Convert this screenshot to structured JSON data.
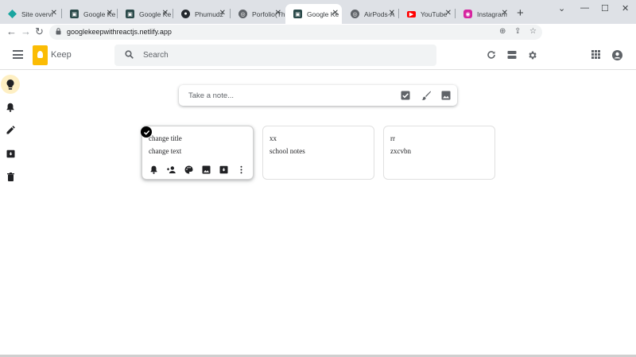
{
  "browser": {
    "tabs": [
      {
        "title": "Site overvi",
        "favicon": "diamond-icon",
        "color": "#1aa5a0"
      },
      {
        "title": "Google Ke",
        "favicon": "keep-icon",
        "color": "#2b4a4a"
      },
      {
        "title": "Google Ke",
        "favicon": "keep-icon",
        "color": "#2b4a4a"
      },
      {
        "title": "Phumudz",
        "favicon": "github-icon",
        "color": "#24292e"
      },
      {
        "title": "Porfolio(Th",
        "favicon": "globe-icon",
        "color": "#5f6368"
      },
      {
        "title": "Google Ke",
        "favicon": "keep-icon",
        "color": "#2b4a4a"
      },
      {
        "title": "AirPods-A",
        "favicon": "globe-icon",
        "color": "#5f6368"
      },
      {
        "title": "YouTube",
        "favicon": "youtube-icon",
        "color": "#ff0000"
      },
      {
        "title": "Instagram",
        "favicon": "instagram-icon",
        "color": "#d6249f"
      }
    ],
    "active_tab_index": 5,
    "url": "googlekeepwithreactjs.netlify.app"
  },
  "app": {
    "name": "Keep",
    "search_placeholder": "Search",
    "accent": "#fbbc04"
  },
  "sidebar": {
    "items": [
      {
        "name": "notes",
        "icon": "lightbulb-icon",
        "active": true
      },
      {
        "name": "reminders",
        "icon": "bell-icon"
      },
      {
        "name": "edit-labels",
        "icon": "pencil-icon"
      },
      {
        "name": "archive",
        "icon": "archive-icon"
      },
      {
        "name": "trash",
        "icon": "trash-icon"
      }
    ]
  },
  "take_note": {
    "placeholder": "Take a note..."
  },
  "notes": [
    {
      "title": "change title",
      "text": "change text"
    },
    {
      "title": "xx",
      "text": "school notes"
    },
    {
      "title": "rr",
      "text": "zxcvbn"
    }
  ]
}
